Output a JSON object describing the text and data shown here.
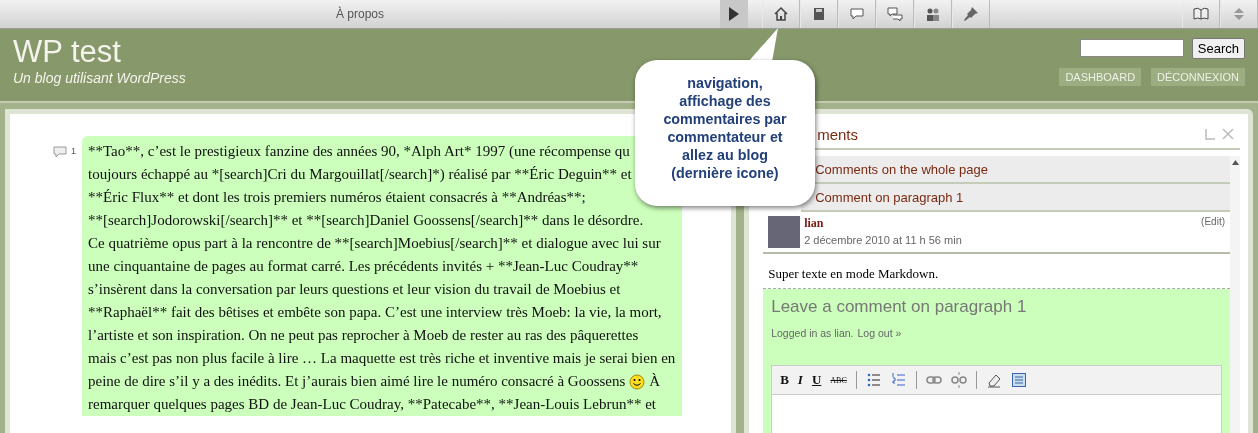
{
  "top_bar": {
    "title": "À propos"
  },
  "site": {
    "title": "WP test",
    "tagline": "Un blog utilisant WordPress"
  },
  "search": {
    "button": "Search"
  },
  "header_links": [
    "DASHBOARD",
    "DÉCONNEXION"
  ],
  "paragraph": {
    "number": "1",
    "lines": [
      {
        "text": "**Tao**, c’est le prestigieux fanzine des années 90, *Alph Art* 1997 (une récompense qu"
      },
      {
        "text": "toujours échappé au *[search]Cri du Margouillat[/search]*) réalisé par **Éric Deguin** et"
      },
      {
        "text": "**Éric Flux** et dont les trois premiers numéros étaient consacrés à **Andréas**;"
      },
      {
        "text": "**[search]Jodorowski[/search]** et **[search]Daniel Goossens[/search]** dans le désordre."
      },
      {
        "text": "Ce quatrième opus part à la rencontre de **[search]Moebius[/search]** et dialogue avec lui sur"
      },
      {
        "text": "une cinquantaine de pages au format carré. Les précédents invités + **Jean-Luc Coudray**"
      },
      {
        "text": "s’insèrent dans la conversation par leurs questions et leur vision du travail de Moebius et"
      },
      {
        "text": "**Raphaël** fait des bêtises et embête son papa. C’est une interview très Moeb: la vie, la mort,"
      },
      {
        "text": "l’artiste et son inspiration. On ne peut pas reprocher à Moeb de rester au ras des pâquerettes"
      },
      {
        "text": "mais c’est pas non plus facile à lire … La maquette est très riche et inventive mais je serai bien en"
      },
      {
        "text": "peine de dire s’il y a des inédits. Et j’aurais bien aimé lire le numéro consacré à Goossens",
        "emoticon": true,
        "continuation": "À"
      },
      {
        "text": "remarquer quelques pages BD de Jean-Luc Coudray, **Patecabe**, **Jean-Louis Lebrun** et"
      }
    ]
  },
  "comments_panel": {
    "title": "ments",
    "sections": [
      {
        "label": "Comments on the whole page"
      },
      {
        "label": "Comment on paragraph 1"
      }
    ],
    "comment": {
      "author": "lian",
      "date": "2 décembre 2010 at 11 h 56 min",
      "edit": "(Edit)",
      "body": "Super texte en mode Markdown."
    },
    "form": {
      "title": "Leave a comment on paragraph 1",
      "logged_in": "Logged in as lian.",
      "logout": "Log out »",
      "format_buttons": [
        {
          "kind": "bold",
          "label": "B"
        },
        {
          "kind": "italic",
          "label": "I"
        },
        {
          "kind": "underline",
          "label": "U"
        },
        {
          "kind": "strike",
          "label": "ABC"
        }
      ]
    }
  },
  "callout": {
    "text": "navigation,\naffichage des\ncommentaires par\ncommentateur et\nallez au blog\n(dernière icone)"
  }
}
